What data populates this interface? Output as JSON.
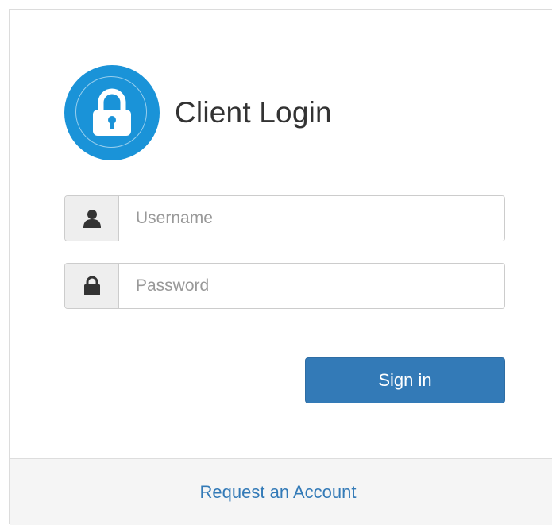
{
  "header": {
    "title": "Client Login",
    "icon": "lock-icon",
    "badge_color": "#1a93d8"
  },
  "form": {
    "username": {
      "icon": "user-icon",
      "placeholder": "Username",
      "value": ""
    },
    "password": {
      "icon": "lock-icon",
      "placeholder": "Password",
      "value": ""
    },
    "submit_label": "Sign in"
  },
  "footer": {
    "request_account_label": "Request an Account"
  },
  "colors": {
    "primary": "#337ab7",
    "title_text": "#333333",
    "addon_bg": "#eeeeee",
    "footer_bg": "#f5f5f5"
  }
}
